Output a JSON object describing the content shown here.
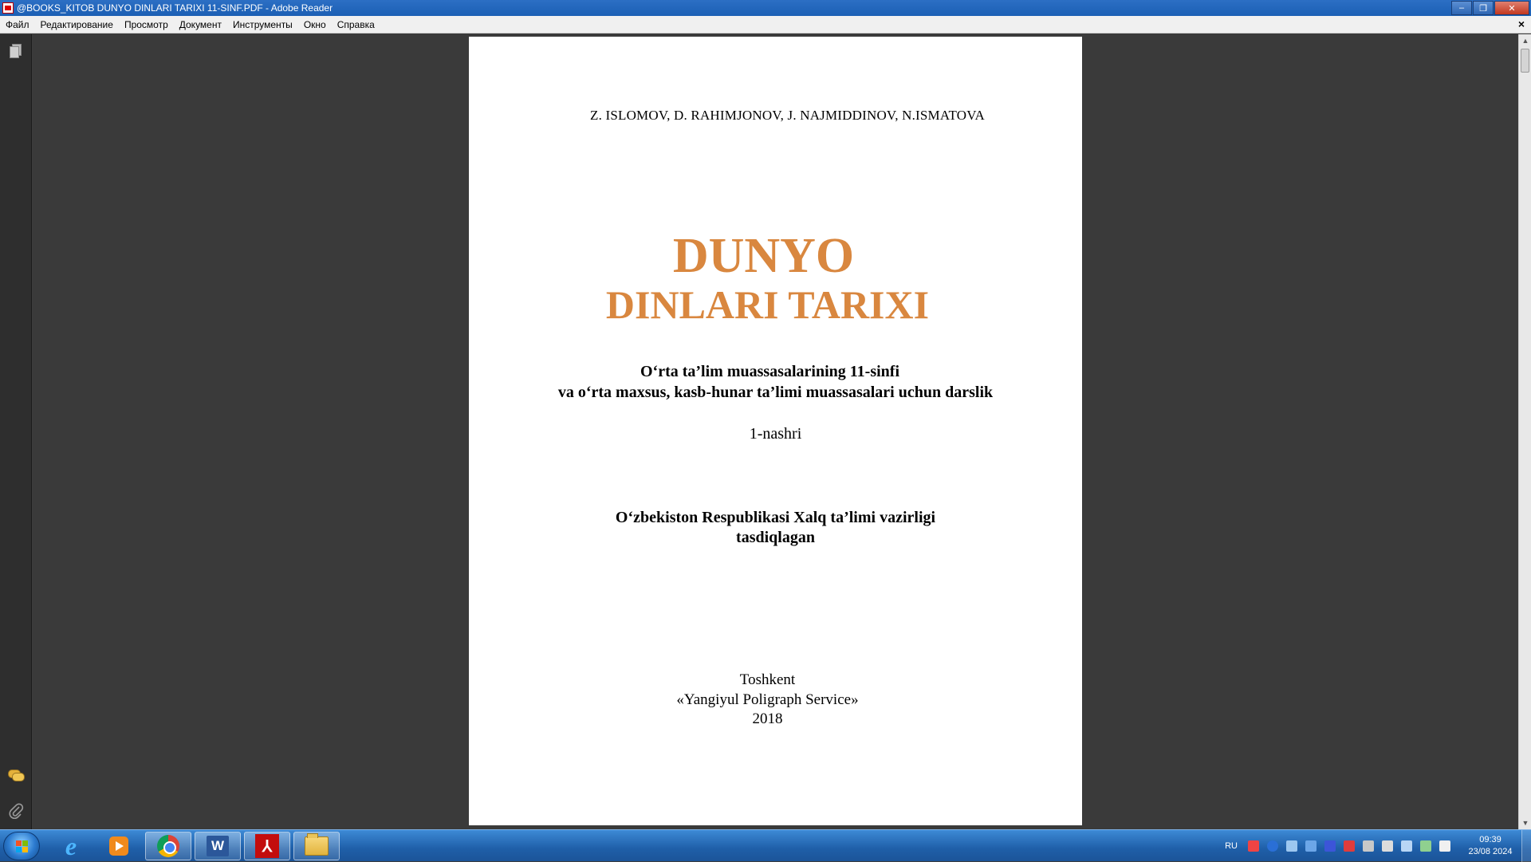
{
  "window": {
    "title": "@BOOKS_KITOB DUNYO DINLARI TARIXI 11-SINF.PDF - Adobe Reader",
    "minimize": "‒",
    "restore": "❐",
    "close": "✕"
  },
  "menu": {
    "items": [
      "Файл",
      "Редактирование",
      "Просмотр",
      "Документ",
      "Инструменты",
      "Окно",
      "Справка"
    ],
    "close": "×"
  },
  "document": {
    "authors": "Z. ISLOMOV, D. RAHIMJONOV, J. NAJMIDDINOV, N.ISMATOVA",
    "title_line1": "DUNYO",
    "title_line2": "DINLARI TARIXI",
    "subtitle_line1": "O‘rta ta’lim muassasalarining 11-sinfi",
    "subtitle_line2": "va o‘rta maxsus, kasb-hunar ta’limi muassasalari uchun darslik",
    "edition": "1-nashri",
    "approved_line1": "O‘zbekiston Respublikasi Xalq ta’limi vazirligi",
    "approved_line2": "tasdiqlagan",
    "city": "Toshkent",
    "publisher": "«Yangiyul Poligraph Service»",
    "year": "2018",
    "title_color": "#d9873f"
  },
  "navpane": {
    "icons": [
      "pages-icon",
      "comments-icon",
      "attachment-icon"
    ]
  },
  "taskbar": {
    "apps": [
      "start-orb",
      "internet-explorer",
      "media-player",
      "chrome",
      "word",
      "adobe-reader",
      "windows-explorer"
    ],
    "language": "RU",
    "time": "09:39",
    "date": "23/08 2024"
  }
}
